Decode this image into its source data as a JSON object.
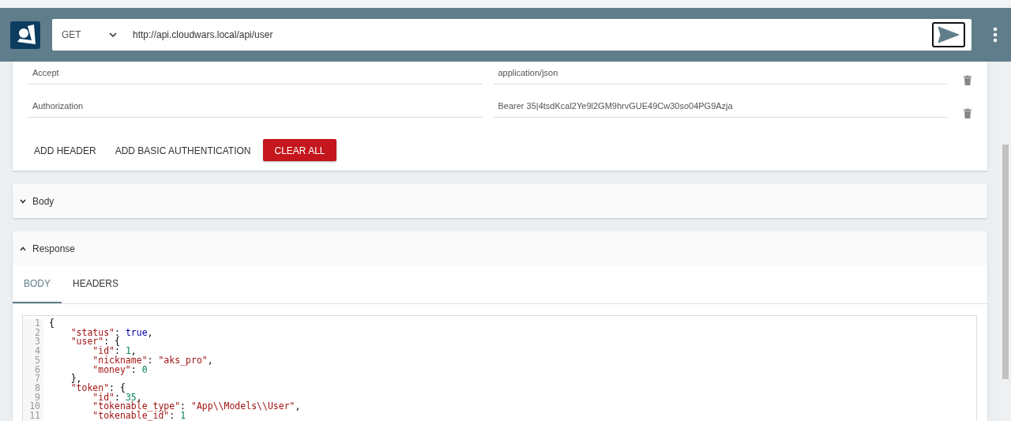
{
  "request": {
    "method": "GET",
    "url": "http://api.cloudwars.local/api/user"
  },
  "headers": [
    {
      "name": "Accept",
      "value": "application/json"
    },
    {
      "name": "Authorization",
      "value": "Bearer 35|4tsdKcal2Ye9l2GM9hrvGUE49Cw30so04PG9Azja"
    }
  ],
  "header_actions": [
    {
      "label": "ADD HEADER",
      "kind": "flat"
    },
    {
      "label": "ADD BASIC AUTHENTICATION",
      "kind": "flat"
    },
    {
      "label": "CLEAR ALL",
      "kind": "danger"
    }
  ],
  "sections": [
    {
      "title": "Body",
      "expanded": false
    },
    {
      "title": "Response",
      "expanded": true
    }
  ],
  "response_tabs": [
    {
      "label": "BODY",
      "selected": true
    },
    {
      "label": "HEADERS",
      "selected": false
    }
  ],
  "code_lines": [
    {
      "number": "1",
      "tokens": [
        {
          "text": "{",
          "kind": "punct"
        }
      ]
    },
    {
      "number": "2",
      "tokens": [
        {
          "text": "    \"status\"",
          "kind": "key"
        },
        {
          "text": ": ",
          "kind": "punct"
        },
        {
          "text": "true",
          "kind": "bool"
        },
        {
          "text": ",",
          "kind": "punct"
        }
      ]
    },
    {
      "number": "3",
      "tokens": [
        {
          "text": "    \"user\"",
          "kind": "key"
        },
        {
          "text": ": {",
          "kind": "punct"
        }
      ]
    },
    {
      "number": "4",
      "tokens": [
        {
          "text": "        \"id\"",
          "kind": "key"
        },
        {
          "text": ": ",
          "kind": "punct"
        },
        {
          "text": "1",
          "kind": "number"
        },
        {
          "text": ",",
          "kind": "punct"
        }
      ]
    },
    {
      "number": "5",
      "tokens": [
        {
          "text": "        \"nickname\"",
          "kind": "key"
        },
        {
          "text": ": ",
          "kind": "punct"
        },
        {
          "text": "\"aks_pro\"",
          "kind": "string"
        },
        {
          "text": ",",
          "kind": "punct"
        }
      ]
    },
    {
      "number": "6",
      "tokens": [
        {
          "text": "        \"money\"",
          "kind": "key"
        },
        {
          "text": ": ",
          "kind": "punct"
        },
        {
          "text": "0",
          "kind": "number"
        }
      ]
    },
    {
      "number": "7",
      "tokens": [
        {
          "text": "    },",
          "kind": "punct"
        }
      ]
    },
    {
      "number": "8",
      "tokens": [
        {
          "text": "    \"token\"",
          "kind": "key"
        },
        {
          "text": ": {",
          "kind": "punct"
        }
      ]
    },
    {
      "number": "9",
      "tokens": [
        {
          "text": "        \"id\"",
          "kind": "key"
        },
        {
          "text": ": ",
          "kind": "punct"
        },
        {
          "text": "35",
          "kind": "number"
        },
        {
          "text": ",",
          "kind": "punct"
        }
      ]
    },
    {
      "number": "10",
      "tokens": [
        {
          "text": "        \"tokenable_type\"",
          "kind": "key"
        },
        {
          "text": ": ",
          "kind": "punct"
        },
        {
          "text": "\"App\\\\Models\\\\User\"",
          "kind": "string"
        },
        {
          "text": ",",
          "kind": "punct"
        }
      ]
    },
    {
      "number": "11",
      "tokens": [
        {
          "text": "        \"tokenable_id\"",
          "kind": "key"
        },
        {
          "text": ": ",
          "kind": "punct"
        },
        {
          "text": "1",
          "kind": "number"
        }
      ]
    }
  ]
}
